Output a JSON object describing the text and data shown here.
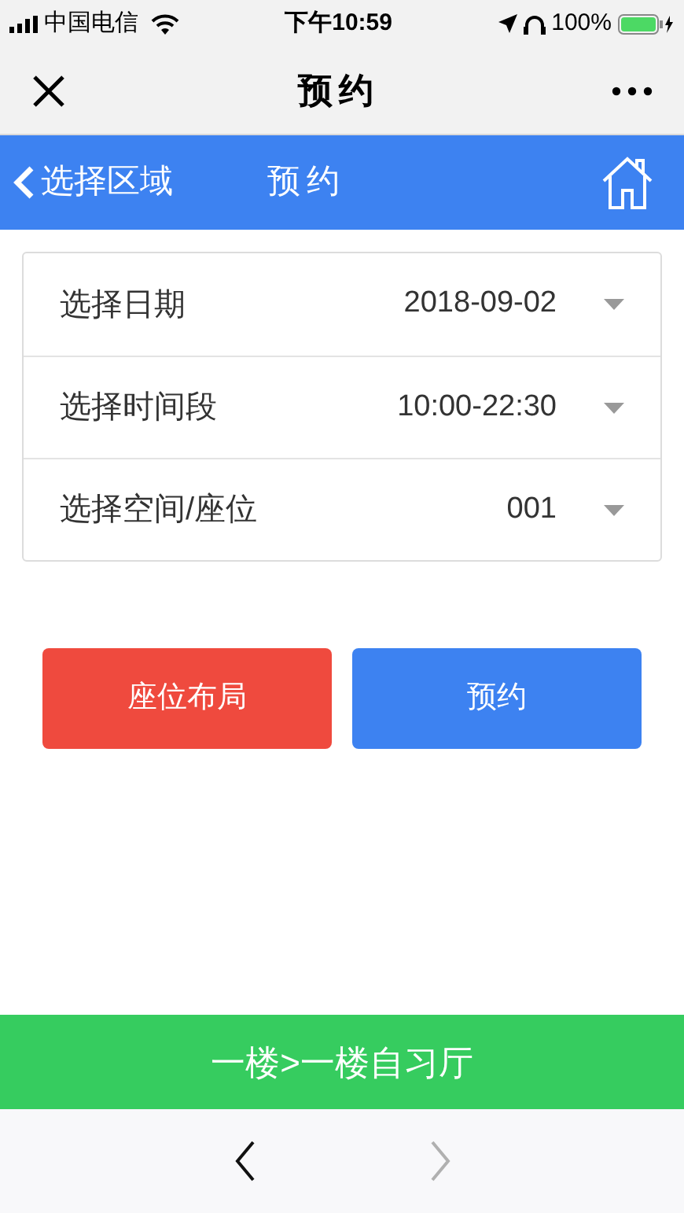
{
  "status_bar": {
    "carrier": "中国电信",
    "time": "下午10:59",
    "battery": "100%"
  },
  "window": {
    "title": "预约"
  },
  "header": {
    "back_label": "选择区域",
    "title": "预约"
  },
  "form": {
    "rows": [
      {
        "label": "选择日期",
        "value": "2018-09-02"
      },
      {
        "label": "选择时间段",
        "value": "10:00-22:30"
      },
      {
        "label": "选择空间/座位",
        "value": "001"
      }
    ]
  },
  "buttons": [
    {
      "label": "座位布局",
      "kind": "secondary"
    },
    {
      "label": "预约",
      "kind": "primary"
    }
  ],
  "location_bar": "一楼>一楼自习厅",
  "nav": [
    {
      "kind": "back",
      "disabled": false
    },
    {
      "kind": "forward",
      "disabled": true
    }
  ]
}
